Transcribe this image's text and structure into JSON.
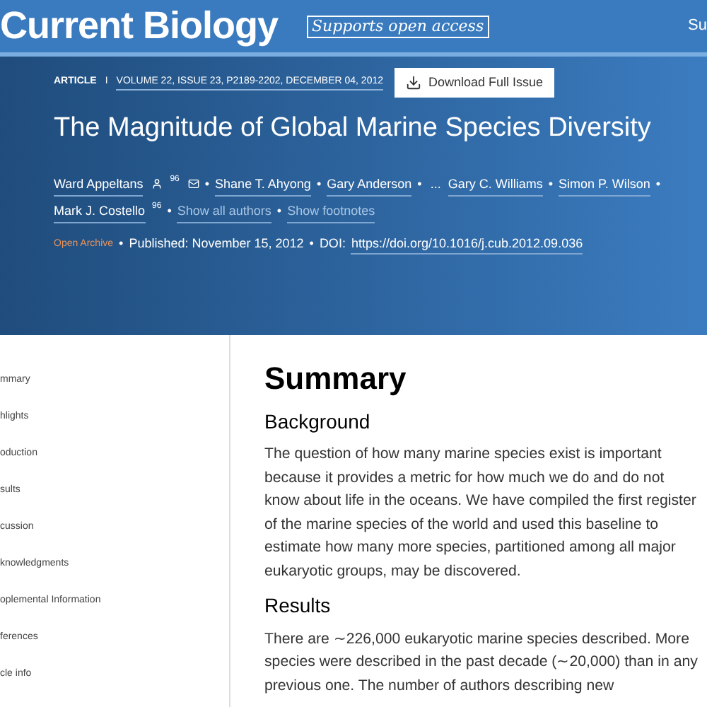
{
  "header": {
    "journal": "Current Biology",
    "badge": "Supports open access",
    "cut_link": "Su"
  },
  "article": {
    "type": "ARTICLE",
    "separator": "I",
    "citation": "VOLUME 22, ISSUE 23, P2189-2202, DECEMBER 04, 2012",
    "download": "Download Full Issue",
    "title": "The Magnitude of Global Marine Species Diversity"
  },
  "authors": [
    {
      "name": "Ward Appeltans",
      "person_icon": true,
      "sup": "96",
      "mail_icon": true,
      "bullet": "•"
    },
    {
      "name": "Shane T. Ahyong",
      "bullet": "•"
    },
    {
      "name": "Gary Anderson",
      "bullet": "•"
    },
    {
      "kind": "ellipsis",
      "name": "..."
    },
    {
      "name": "Gary C. Williams",
      "bullet": "•"
    },
    {
      "name": "Simon P. Wilson",
      "bullet": "•"
    },
    {
      "name": "Mark J. Costello",
      "sup": "96",
      "bullet": "•"
    },
    {
      "kind": "toggle",
      "name": "Show all authors",
      "bullet": "•"
    },
    {
      "kind": "toggle",
      "name": "Show footnotes"
    }
  ],
  "meta": {
    "access": "Open Archive",
    "bullet": "•",
    "published": "Published: November 15, 2012",
    "doi_label": "DOI:",
    "doi": "https://doi.org/10.1016/j.cub.2012.09.036"
  },
  "sidebar": {
    "items": [
      "mmary",
      "hlights",
      "oduction",
      "sults",
      "cussion",
      "knowledgments",
      "oplemental Information",
      "ferences",
      "cle info"
    ]
  },
  "content": {
    "heading": "Summary",
    "sections": [
      {
        "heading": "Background",
        "text": "The question of how many marine species exist is important because it provides a metric for how much we do and do not know about life in the oceans. We have compiled the first register of the marine species of the world and used this baseline to estimate how many more species, partitioned among all major eukaryotic groups, may be discovered."
      },
      {
        "heading": "Results",
        "text": "There are ∼226,000 eukaryotic marine species described. More species were described in the past decade (∼20,000) than in any previous one. The number of authors describing new"
      }
    ]
  }
}
